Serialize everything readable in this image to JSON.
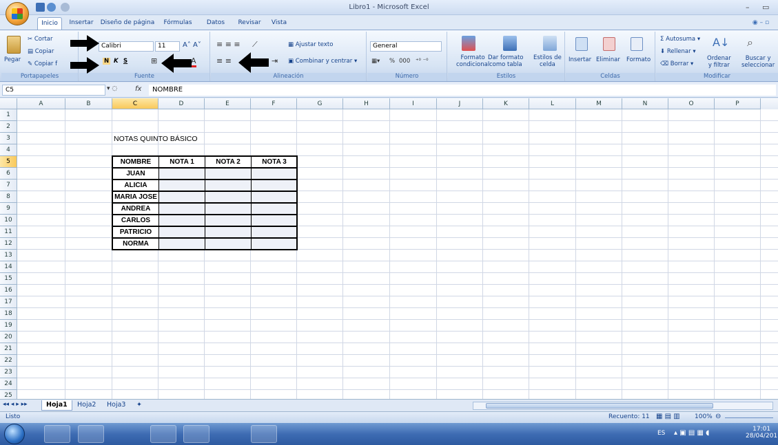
{
  "window": {
    "title": "Libro1 - Microsoft Excel"
  },
  "tabs": [
    "Inicio",
    "Insertar",
    "Diseño de página",
    "Fórmulas",
    "Datos",
    "Revisar",
    "Vista"
  ],
  "clipboard": {
    "paste": "Pegar",
    "cut": "Cortar",
    "copy": "Copiar",
    "format_painter": "Copiar f",
    "group": "Portapapeles"
  },
  "font": {
    "name": "Calibri",
    "size": "11",
    "bold": "N",
    "italic": "K",
    "underline": "S",
    "group": "Fuente"
  },
  "alignment": {
    "wrap": "Ajustar texto",
    "merge": "Combinar y centrar",
    "group": "Alineación"
  },
  "number": {
    "format": "General",
    "percent": "%",
    "thousands": "000",
    "group": "Número"
  },
  "styles": {
    "conditional": [
      "Formato",
      "condicional"
    ],
    "as_table": [
      "Dar formato",
      "como tabla"
    ],
    "cell_styles": [
      "Estilos de",
      "celda"
    ],
    "group": "Estilos"
  },
  "cells": {
    "insert": "Insertar",
    "delete": "Eliminar",
    "format": "Formato",
    "group": "Celdas"
  },
  "editing": {
    "autosum": "Autosuma",
    "fill": "Rellenar",
    "clear": "Borrar",
    "sort": [
      "Ordenar",
      "y filtrar"
    ],
    "find": [
      "Buscar y",
      "seleccionar"
    ],
    "group": "Modificar"
  },
  "formula_bar": {
    "cell_ref": "C5",
    "fx": "fx",
    "content": "NOMBRE"
  },
  "columns": [
    "A",
    "B",
    "C",
    "D",
    "E",
    "F",
    "G",
    "H",
    "I",
    "J",
    "K",
    "L",
    "M",
    "N",
    "O",
    "P"
  ],
  "rows": [
    "1",
    "2",
    "3",
    "4",
    "5",
    "6",
    "7",
    "8",
    "9",
    "10",
    "11",
    "12",
    "13",
    "14",
    "15",
    "16",
    "17",
    "18",
    "19",
    "20",
    "21",
    "22",
    "23",
    "24",
    "25"
  ],
  "sheet": {
    "title": "NOTAS QUINTO BÁSICO",
    "headers": [
      "NOMBRE",
      "NOTA 1",
      "NOTA 2",
      "NOTA 3"
    ],
    "names": [
      "JUAN",
      "ALICIA",
      "MARIA JOSE",
      "ANDREA",
      "CARLOS",
      "PATRICIO",
      "NORMA"
    ]
  },
  "sheet_tabs": [
    "Hoja1",
    "Hoja2",
    "Hoja3"
  ],
  "status": {
    "ready": "Listo",
    "count": "Recuento: 11",
    "zoom": "100%"
  },
  "taskbar": {
    "lang": "ES",
    "time": "17:01",
    "date": "28/04/201"
  }
}
